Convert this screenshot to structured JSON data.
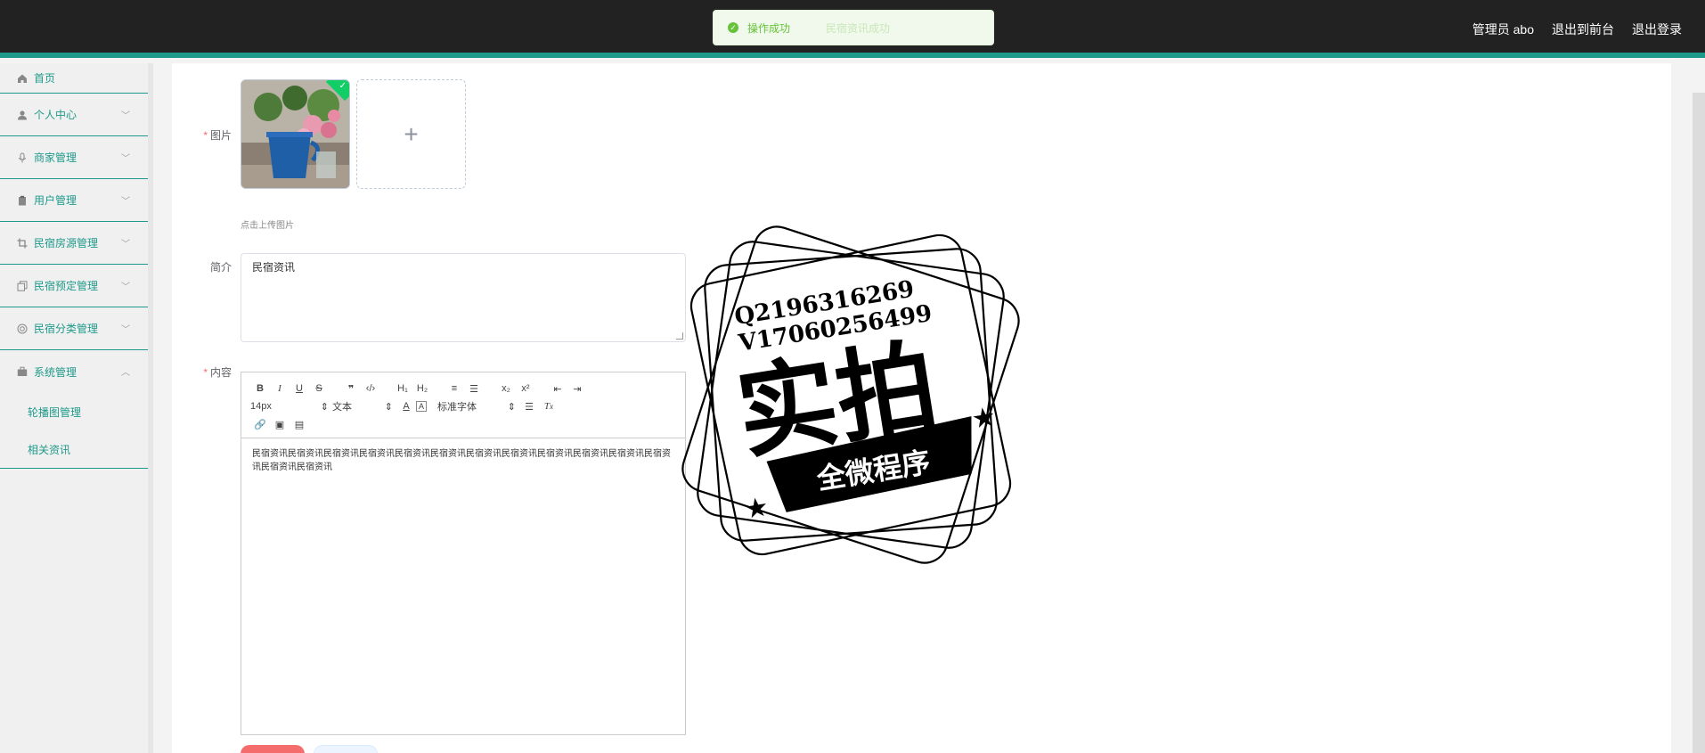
{
  "header": {
    "user_label": "管理员 abo",
    "front_label": "退出到前台",
    "logout_label": "退出登录"
  },
  "toast": {
    "message": "操作成功",
    "faded_text": "民宿资讯成功"
  },
  "sidebar": {
    "items": [
      {
        "label": "首页",
        "icon": "home-icon"
      },
      {
        "label": "个人中心",
        "icon": "user-icon"
      },
      {
        "label": "商家管理",
        "icon": "mic-icon"
      },
      {
        "label": "用户管理",
        "icon": "clipboard-icon"
      },
      {
        "label": "民宿房源管理",
        "icon": "crop-icon"
      },
      {
        "label": "民宿预定管理",
        "icon": "copy-icon"
      },
      {
        "label": "民宿分类管理",
        "icon": "circle-icon"
      },
      {
        "label": "系统管理",
        "icon": "briefcase-icon"
      }
    ],
    "submenu": [
      {
        "label": "轮播图管理"
      },
      {
        "label": "相关资讯"
      }
    ]
  },
  "form": {
    "image_label": "图片",
    "upload_hint": "点击上传图片",
    "intro_label": "简介",
    "intro_value": "民宿资讯",
    "content_label": "内容",
    "content_text": "民宿资讯民宿资讯民宿资讯民宿资讯民宿资讯民宿资讯民宿资讯民宿资讯民宿资讯民宿资讯民宿资讯民宿资讯民宿资讯民宿资讯"
  },
  "editor_toolbar": {
    "font_size": "14px",
    "text_type": "文本",
    "font_family": "标准字体"
  },
  "watermark": {
    "qq": "Q2196316269",
    "wechat": "V17060256499",
    "big": "实拍",
    "banner": "全微程序"
  },
  "colors": {
    "accent": "#1e9a8a",
    "topbar": "#222222",
    "success": "#67c23a",
    "danger": "#f56c6c"
  }
}
